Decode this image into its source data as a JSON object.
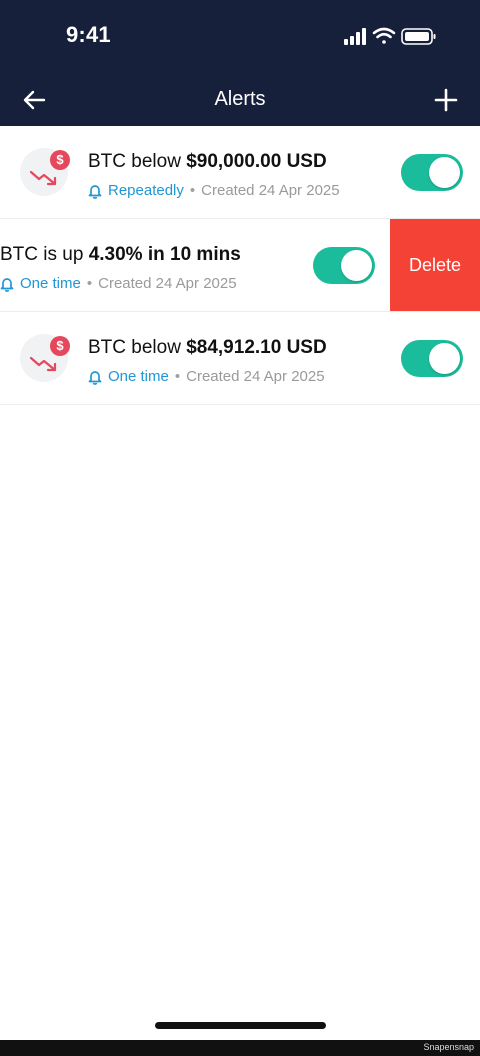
{
  "status_bar": {
    "time": "9:41",
    "icons": [
      "signal-icon",
      "wifi-icon",
      "battery-icon"
    ]
  },
  "header": {
    "title": "Alerts",
    "back_icon": "arrow-left-icon",
    "add_icon": "plus-icon",
    "background": "#17203a"
  },
  "alerts": [
    {
      "prefix": "BTC below ",
      "value": "$90,000.00 USD",
      "frequency": "Repeatedly",
      "separator": "•",
      "created": "Created 24 Apr 2025",
      "enabled": true,
      "icon": "price-down-icon"
    },
    {
      "prefix": "BTC is up ",
      "value": "4.30% in 10 mins",
      "frequency": "One time",
      "separator": "•",
      "created": "Created 24 Apr 2025",
      "enabled": true,
      "swiped": true,
      "delete_label": "Delete"
    },
    {
      "prefix": "BTC below ",
      "value": "$84,912.10 USD",
      "frequency": "One time",
      "separator": "•",
      "created": "Created 24 Apr 2025",
      "enabled": true,
      "icon": "price-down-icon"
    }
  ],
  "colors": {
    "toggle_on": "#1bbc9b",
    "delete": "#f44336",
    "frequency": "#1f97d4",
    "badge": "#e5485d"
  },
  "watermark": "Snapensnap"
}
